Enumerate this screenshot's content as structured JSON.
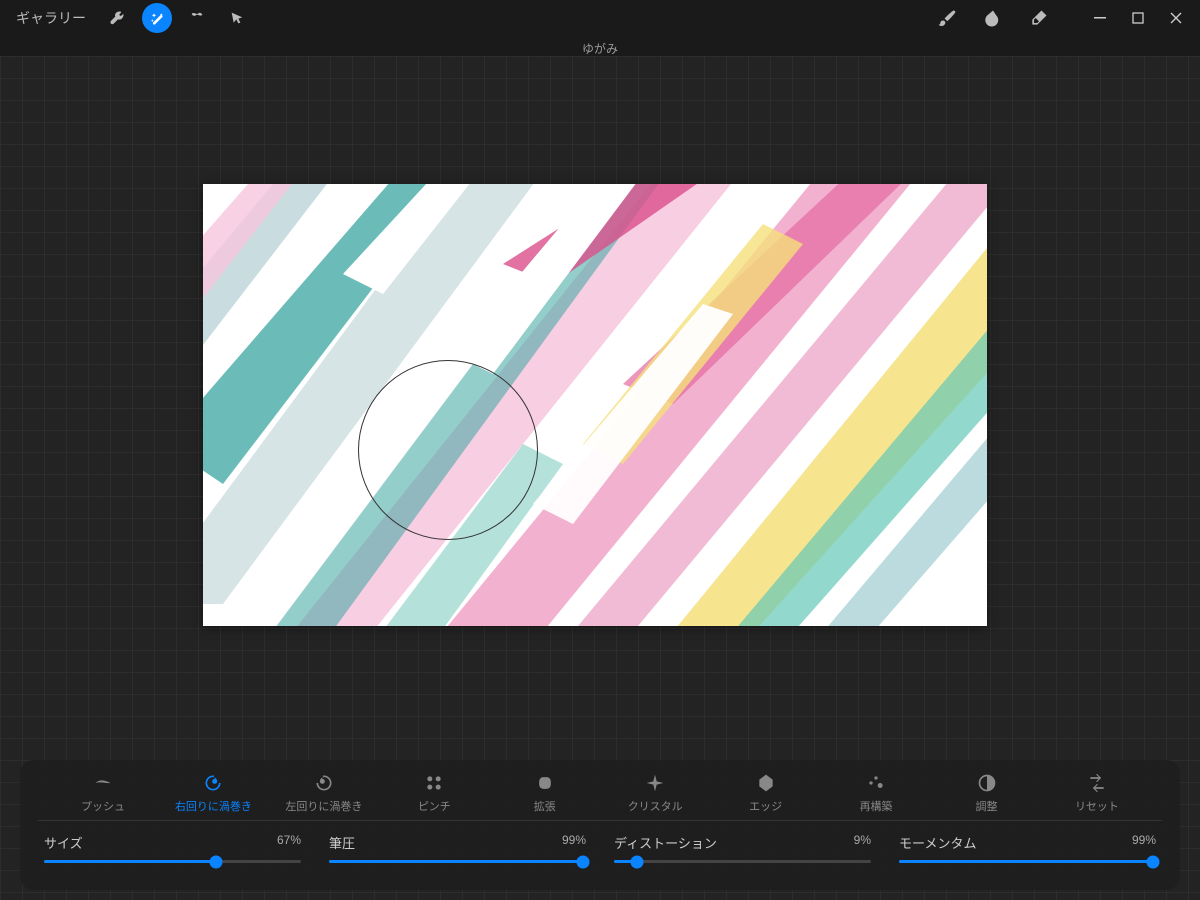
{
  "topbar": {
    "gallery_label": "ギャラリー"
  },
  "document": {
    "title": "ゆがみ"
  },
  "modes": [
    {
      "id": "push",
      "label": "プッシュ"
    },
    {
      "id": "twirl-r",
      "label": "右回りに渦巻き"
    },
    {
      "id": "twirl-l",
      "label": "左回りに渦巻き"
    },
    {
      "id": "pinch",
      "label": "ピンチ"
    },
    {
      "id": "expand",
      "label": "拡張"
    },
    {
      "id": "crystal",
      "label": "クリスタル"
    },
    {
      "id": "edge",
      "label": "エッジ"
    },
    {
      "id": "rebuild",
      "label": "再構築"
    },
    {
      "id": "adjust",
      "label": "調整"
    },
    {
      "id": "reset",
      "label": "リセット"
    }
  ],
  "active_mode": "twirl-r",
  "sliders": {
    "size": {
      "label": "サイズ",
      "value": 67,
      "display": "67%"
    },
    "pressure": {
      "label": "筆圧",
      "value": 99,
      "display": "99%"
    },
    "distortion": {
      "label": "ディストーション",
      "value": 9,
      "display": "9%"
    },
    "momentum": {
      "label": "モーメンタム",
      "value": 99,
      "display": "99%"
    }
  },
  "colors": {
    "accent": "#0a84ff"
  }
}
